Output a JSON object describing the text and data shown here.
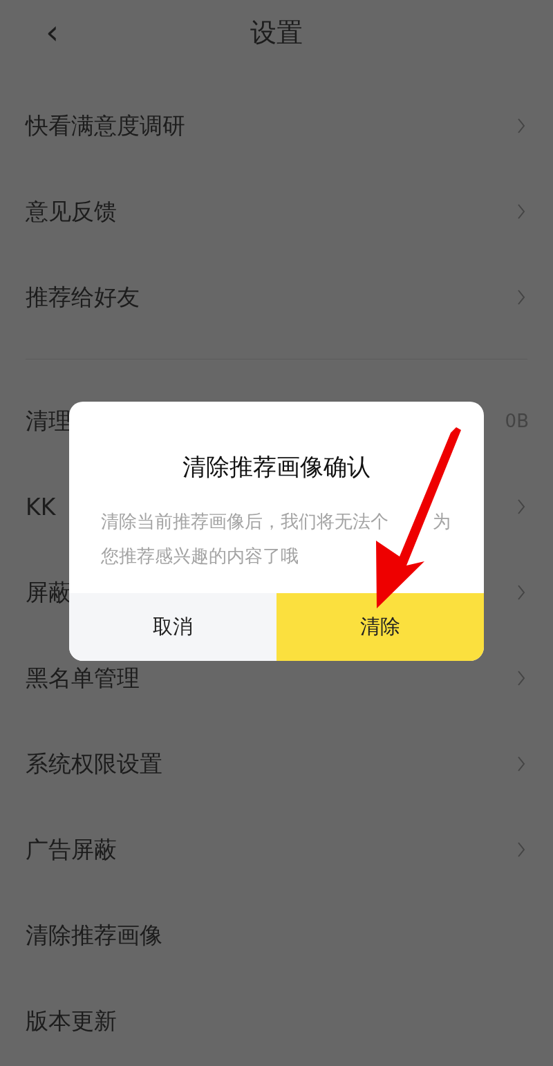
{
  "header": {
    "back": "‹",
    "title": "设置"
  },
  "sections": [
    {
      "rows": [
        {
          "label": "快看满意度调研",
          "kind": "chevron"
        },
        {
          "label": "意见反馈",
          "kind": "chevron"
        },
        {
          "label": "推荐给好友",
          "kind": "chevron"
        }
      ]
    },
    {
      "rows": [
        {
          "label": "清理",
          "kind": "value",
          "value": "0B"
        },
        {
          "label": "KK",
          "kind": "chevron"
        },
        {
          "label": "屏蔽",
          "kind": "chevron"
        },
        {
          "label": "黑名单管理",
          "kind": "chevron"
        },
        {
          "label": "系统权限设置",
          "kind": "chevron"
        },
        {
          "label": "广告屏蔽",
          "kind": "chevron"
        },
        {
          "label": "清除推荐画像",
          "kind": "plain"
        },
        {
          "label": "版本更新",
          "kind": "plain"
        }
      ]
    }
  ],
  "dialog": {
    "title": "清除推荐画像确认",
    "message": {
      "before_arrow": "清除当前推荐画像后，我们将无法个",
      "after_arrow": "为",
      "second_line": "您推荐感兴趣的内容了哦"
    },
    "cancel": "取消",
    "confirm": "清除"
  }
}
